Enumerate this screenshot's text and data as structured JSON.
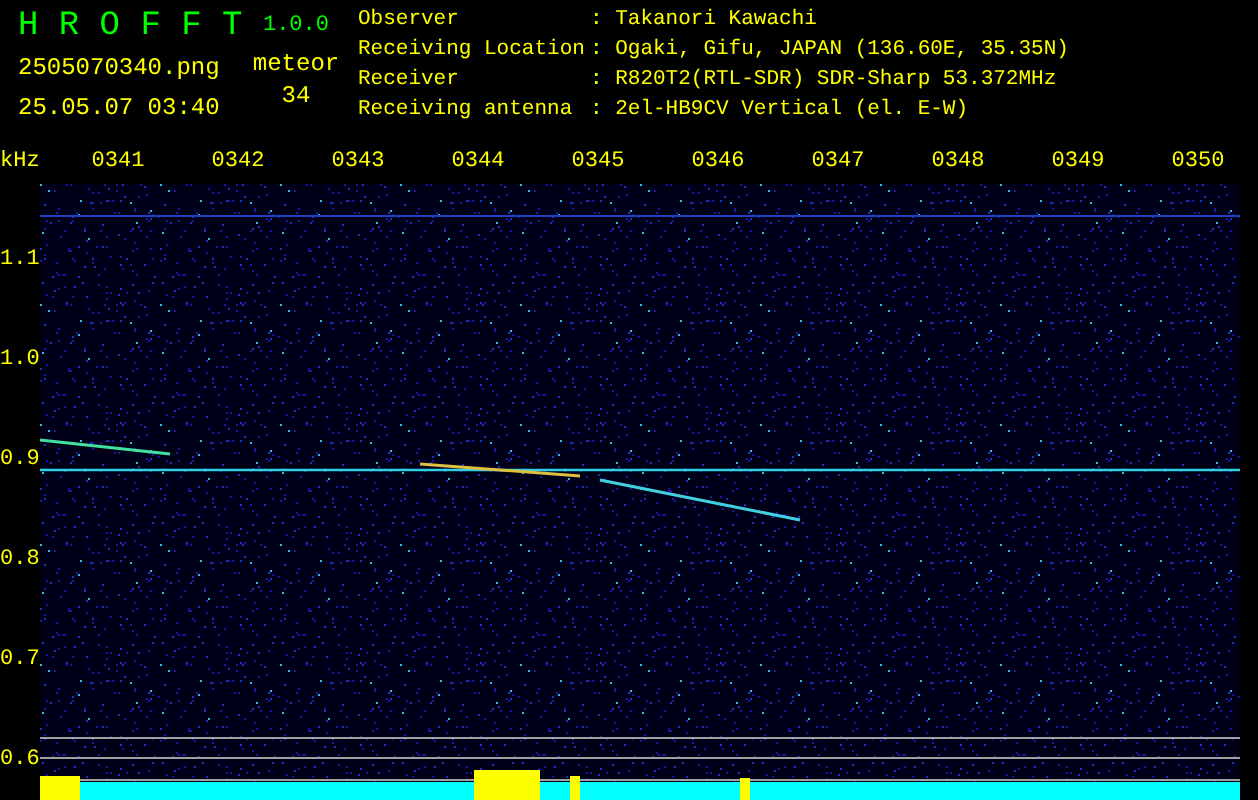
{
  "header": {
    "app_name": "H R O F F T",
    "version": "1.0.0",
    "filename": "2505070340.png",
    "datetime": "25.05.07 03:40",
    "meteor_label": "meteor",
    "meteor_count": "34"
  },
  "info": [
    {
      "label": "Observer",
      "value": ": Takanori Kawachi"
    },
    {
      "label": "Receiving Location",
      "value": ": Ogaki, Gifu, JAPAN (136.60E, 35.35N)"
    },
    {
      "label": "Receiver",
      "value": ": R820T2(RTL-SDR) SDR-Sharp 53.372MHz"
    },
    {
      "label": "Receiving antenna",
      "value": ": 2el-HB9CV Vertical (el. E-W)"
    }
  ],
  "freq_axis": {
    "unit": "kHz",
    "labels": [
      "1.1",
      "1.0",
      "0.9",
      "0.8",
      "0.7",
      "0.6"
    ]
  },
  "time_axis": {
    "labels": [
      "0341",
      "0342",
      "0343",
      "0344",
      "0345",
      "0346",
      "0347",
      "0348",
      "0349",
      "0350"
    ]
  }
}
